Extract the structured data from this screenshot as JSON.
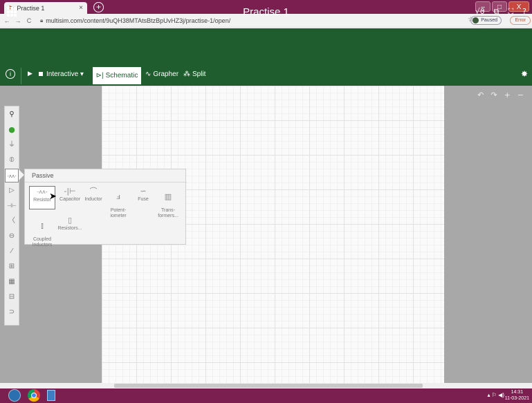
{
  "browser": {
    "tab_title": "Practise 1",
    "tab_close": "×",
    "new_tab": "+",
    "url": "multisim.com/content/9uQH38MTAtsBtzBpUvHZ3j/practise-1/open/",
    "nav_back": "←",
    "nav_forward": "→",
    "nav_reload": "C",
    "paused_label": "Paused",
    "error_label": "Error",
    "star": "☆",
    "win_minimize": "–",
    "win_maximize": "□",
    "win_close": "X"
  },
  "header": {
    "title": "Practise 1",
    "tools": [
      "√ϑ",
      "⧉",
      "⛶",
      "?"
    ]
  },
  "toolbar": {
    "info": "i",
    "play": "▶",
    "interactive_label": "Interactive ▾",
    "schematic_icon": "⊳|",
    "schematic_label": "Schematic",
    "grapher_icon": "∿",
    "grapher_label": "Grapher",
    "split_icon": "⁂",
    "split_label": "Split",
    "settings": "✸"
  },
  "canvas": {
    "undo": "↶",
    "redo": "↷",
    "zoom_in": "+",
    "zoom_out": "−"
  },
  "palette": {
    "items": [
      {
        "icon": "search-icon",
        "glyph": "⚲"
      },
      {
        "icon": "probe-icon",
        "glyph": "●"
      },
      {
        "icon": "ground-icon",
        "glyph": "⏚"
      },
      {
        "icon": "source-icon",
        "glyph": "⦶"
      },
      {
        "icon": "resistor-icon",
        "glyph": "-ᴧᴧ-"
      },
      {
        "icon": "diode-icon",
        "glyph": "▷"
      },
      {
        "icon": "transistor-icon",
        "glyph": "⊣⊢"
      },
      {
        "icon": "opamp-icon",
        "glyph": "〈"
      },
      {
        "icon": "meter-icon",
        "glyph": "⊖"
      },
      {
        "icon": "switch-icon",
        "glyph": "⁄"
      },
      {
        "icon": "ic-icon",
        "glyph": "⊞"
      },
      {
        "icon": "mcu-icon",
        "glyph": "▦"
      },
      {
        "icon": "connector-icon",
        "glyph": "⊟"
      },
      {
        "icon": "logic-icon",
        "glyph": "⊃"
      }
    ]
  },
  "passive": {
    "title": "Passive",
    "components": [
      {
        "label": "Resistor",
        "glyph": "-ᴧᴧ-"
      },
      {
        "label": "Capacitor",
        "glyph": "-|⊢"
      },
      {
        "label": "Inductor",
        "glyph": "⌒"
      },
      {
        "label": "Potent-\niometer",
        "glyph": "ⅎ"
      },
      {
        "label": "Fuse",
        "glyph": "∽"
      },
      {
        "label": "Trans-\nformers...",
        "glyph": "▥"
      },
      {
        "label": "Coupled\nInductors",
        "glyph": "⫾"
      },
      {
        "label": "Resistors...",
        "glyph": "▯"
      }
    ]
  },
  "taskbar": {
    "tray": "▴ ⚐ ◀)",
    "time": "14:31",
    "date": "11-03-2021"
  }
}
